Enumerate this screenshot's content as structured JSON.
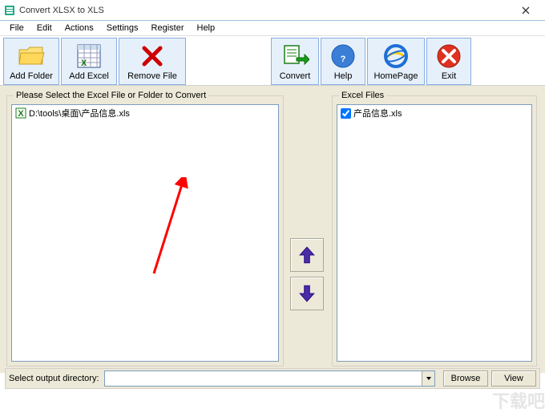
{
  "title": "Convert XLSX to XLS",
  "menu": {
    "file": "File",
    "edit": "Edit",
    "actions": "Actions",
    "settings": "Settings",
    "register": "Register",
    "help": "Help"
  },
  "toolbar": {
    "add_folder": "Add Folder",
    "add_excel": "Add Excel",
    "remove_file": "Remove File",
    "convert": "Convert",
    "help": "Help",
    "homepage": "HomePage",
    "exit": "Exit"
  },
  "left": {
    "legend": "Please Select the Excel File or Folder to Convert",
    "items": [
      {
        "path": "D:\\tools\\桌面\\产品信息.xls"
      }
    ]
  },
  "right": {
    "legend": "Excel Files",
    "items": [
      {
        "name": "产品信息.xls",
        "checked": true
      }
    ]
  },
  "footer": {
    "label": "Select  output directory:",
    "value": "",
    "browse": "Browse",
    "view": "View"
  },
  "watermark": "下载吧"
}
